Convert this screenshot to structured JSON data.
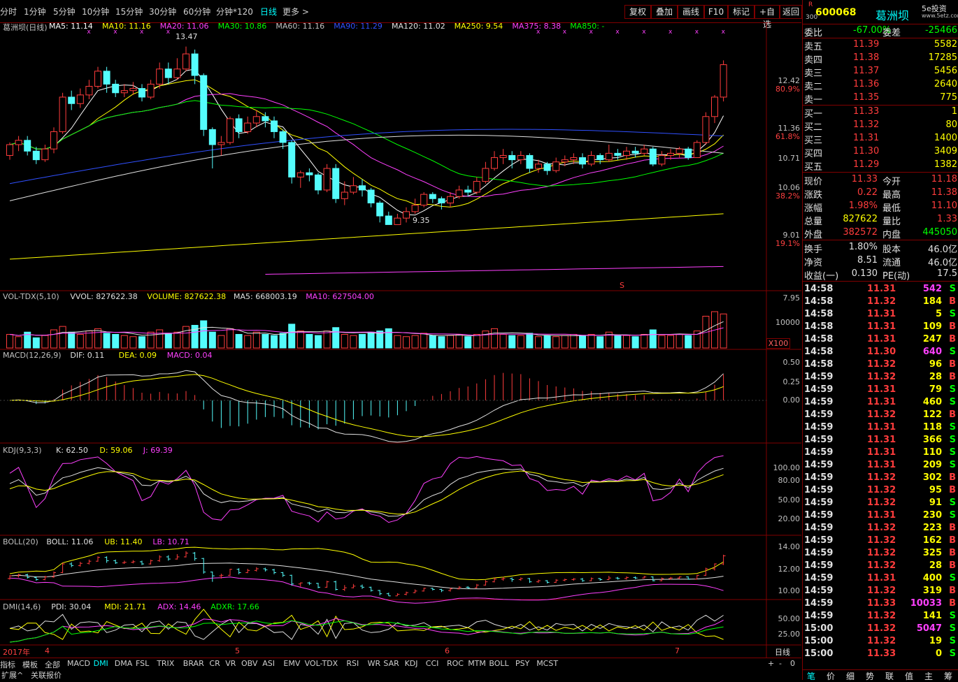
{
  "period_tabs": [
    "分时",
    "1分钟",
    "5分钟",
    "10分钟",
    "15分钟",
    "30分钟",
    "60分钟",
    "分钟*120",
    "日线",
    "更多 >"
  ],
  "active_period": "日线",
  "toolbar_buttons": [
    "复权",
    "叠加",
    "画线",
    "F10",
    "标记",
    "+自选",
    "返回"
  ],
  "main_legend": {
    "stock": "葛洲坝(日线)",
    "items": [
      {
        "label": "MA5: 11.14",
        "color": "#ffffff"
      },
      {
        "label": "MA10: 11.16",
        "color": "#ffff00"
      },
      {
        "label": "MA20: 11.06",
        "color": "#ff40ff"
      },
      {
        "label": "MA30: 10.86",
        "color": "#00ff00"
      },
      {
        "label": "MA60: 11.16",
        "color": "#c0c0c0"
      },
      {
        "label": "MA90: 11.29",
        "color": "#3050ff"
      },
      {
        "label": "MA120: 11.02",
        "color": "#e0e0e0"
      },
      {
        "label": "MA250: 9.54",
        "color": "#ffff00"
      },
      {
        "label": "MA375: 8.38",
        "color": "#ff40ff"
      },
      {
        "label": "MA850: -",
        "color": "#00ff00"
      }
    ]
  },
  "price_axis": [
    {
      "value": "12.42",
      "pct": "80.9%"
    },
    {
      "value": "11.36",
      "pct": "61.8%"
    },
    {
      "value": "10.71",
      "pct": ""
    },
    {
      "value": "10.06",
      "pct": "38.2%"
    },
    {
      "value": "9.01",
      "pct": "19.1%"
    },
    {
      "value": "7.95",
      "pct": ""
    }
  ],
  "annotations": {
    "high": "13.47",
    "low": "9.35"
  },
  "vol_legend": [
    {
      "label": "VOL-TDX(5,10)",
      "color": "#c0c0c0"
    },
    {
      "label": "VVOL: 827622.38",
      "color": "#e0e0e0"
    },
    {
      "label": "VOLUME: 827622.38",
      "color": "#ffff00"
    },
    {
      "label": "MA5: 668003.19",
      "color": "#e0e0e0"
    },
    {
      "label": "MA10: 627504.00",
      "color": "#ff40ff"
    }
  ],
  "vol_axis": {
    "tick": "10000",
    "unit": "X100"
  },
  "macd_legend": [
    {
      "label": "MACD(12,26,9)",
      "color": "#c0c0c0"
    },
    {
      "label": "DIF: 0.11",
      "color": "#e0e0e0"
    },
    {
      "label": "DEA: 0.09",
      "color": "#ffff00"
    },
    {
      "label": "MACD: 0.04",
      "color": "#ff40ff"
    }
  ],
  "macd_axis": [
    "0.50",
    "0.25",
    "0.00"
  ],
  "kdj_legend": [
    {
      "label": "KDJ(9,3,3)",
      "color": "#c0c0c0"
    },
    {
      "label": "K: 62.50",
      "color": "#e0e0e0"
    },
    {
      "label": "D: 59.06",
      "color": "#ffff00"
    },
    {
      "label": "J: 69.39",
      "color": "#ff40ff"
    }
  ],
  "kdj_axis": [
    "100.00",
    "80.00",
    "50.00",
    "20.00"
  ],
  "boll_legend": [
    {
      "label": "BOLL(20)",
      "color": "#c0c0c0"
    },
    {
      "label": "BOLL: 11.06",
      "color": "#e0e0e0"
    },
    {
      "label": "UB: 11.40",
      "color": "#ffff00"
    },
    {
      "label": "LB: 10.71",
      "color": "#ff40ff"
    }
  ],
  "boll_axis": [
    "14.00",
    "12.00",
    "10.00"
  ],
  "dmi_legend": [
    {
      "label": "DMI(14,6)",
      "color": "#c0c0c0"
    },
    {
      "label": "PDI: 30.04",
      "color": "#e0e0e0"
    },
    {
      "label": "MDI: 21.71",
      "color": "#ffff00"
    },
    {
      "label": "ADX: 14.46",
      "color": "#ff40ff"
    },
    {
      "label": "ADXR: 17.66",
      "color": "#00ff00"
    }
  ],
  "dmi_axis": [
    "50.00",
    "25.00"
  ],
  "date_axis": [
    "2017年",
    "4",
    "5",
    "6",
    "7"
  ],
  "date_axis_right": "日线",
  "indicator_tabs": [
    "指标",
    "模板",
    "全部",
    "MACD",
    "DMI",
    "DMA",
    "FSL",
    "TRIX",
    "BRAR",
    "CR",
    "VR",
    "OBV",
    "ASI",
    "EMV",
    "VOL-TDX",
    "RSI",
    "WR",
    "SAR",
    "KDJ",
    "CCI",
    "ROC",
    "MTM",
    "BOLL",
    "PSY",
    "MCST"
  ],
  "active_indicator": "DMI",
  "bottom_tabs": [
    "扩展^",
    "关联报价"
  ],
  "zoom_controls": [
    "+",
    "-",
    "0"
  ],
  "quote": {
    "code": "600068",
    "name": "葛洲坝",
    "market_tag": "R",
    "market_tag2": "300",
    "brand": "5e投资",
    "brand_sub": "www.5etz.com",
    "weibi_label": "委比",
    "weibi": "-67.00%",
    "weicha_label": "委差",
    "weicha": "-25466",
    "asks": [
      {
        "label": "卖五",
        "price": "11.39",
        "vol": "5582"
      },
      {
        "label": "卖四",
        "price": "11.38",
        "vol": "17285"
      },
      {
        "label": "卖三",
        "price": "11.37",
        "vol": "5456"
      },
      {
        "label": "卖二",
        "price": "11.36",
        "vol": "2640"
      },
      {
        "label": "卖一",
        "price": "11.35",
        "vol": "775"
      }
    ],
    "bids": [
      {
        "label": "买一",
        "price": "11.33",
        "vol": "1"
      },
      {
        "label": "买二",
        "price": "11.32",
        "vol": "80"
      },
      {
        "label": "买三",
        "price": "11.31",
        "vol": "1400"
      },
      {
        "label": "买四",
        "price": "11.30",
        "vol": "3409"
      },
      {
        "label": "买五",
        "price": "11.29",
        "vol": "1382"
      }
    ],
    "stats": [
      {
        "l1": "现价",
        "v1": "11.33",
        "c1": "red",
        "l2": "今开",
        "v2": "11.18",
        "c2": "red"
      },
      {
        "l1": "涨跌",
        "v1": "0.22",
        "c1": "red",
        "l2": "最高",
        "v2": "11.38",
        "c2": "red"
      },
      {
        "l1": "涨幅",
        "v1": "1.98%",
        "c1": "red",
        "l2": "最低",
        "v2": "11.10",
        "c2": "red"
      },
      {
        "l1": "总量",
        "v1": "827622",
        "c1": "yel",
        "l2": "量比",
        "v2": "1.33",
        "c2": "red"
      },
      {
        "l1": "外盘",
        "v1": "382572",
        "c1": "red",
        "l2": "内盘",
        "v2": "445050",
        "c2": "grn"
      }
    ],
    "stats2": [
      {
        "l1": "换手",
        "v1": "1.80%",
        "l2": "股本",
        "v2": "46.0亿"
      },
      {
        "l1": "净资",
        "v1": "8.51",
        "l2": "流通",
        "v2": "46.0亿"
      },
      {
        "l1": "收益(一)",
        "v1": "0.130",
        "l2": "PE(动)",
        "v2": "17.5"
      }
    ]
  },
  "ticks": [
    {
      "t": "14:58",
      "p": "11.31",
      "v": "542",
      "s": "S",
      "pc": "red",
      "vc": "mag",
      "sc": "grn"
    },
    {
      "t": "14:58",
      "p": "11.32",
      "v": "184",
      "s": "B",
      "pc": "red",
      "vc": "yel",
      "sc": "red"
    },
    {
      "t": "14:58",
      "p": "11.31",
      "v": "5",
      "s": "S",
      "pc": "red",
      "vc": "yel",
      "sc": "grn"
    },
    {
      "t": "14:58",
      "p": "11.31",
      "v": "109",
      "s": "B",
      "pc": "red",
      "vc": "yel",
      "sc": "red"
    },
    {
      "t": "14:58",
      "p": "11.31",
      "v": "247",
      "s": "B",
      "pc": "red",
      "vc": "yel",
      "sc": "red"
    },
    {
      "t": "14:58",
      "p": "11.30",
      "v": "640",
      "s": "S",
      "pc": "red",
      "vc": "mag",
      "sc": "grn"
    },
    {
      "t": "14:58",
      "p": "11.32",
      "v": "96",
      "s": "B",
      "pc": "red",
      "vc": "yel",
      "sc": "red"
    },
    {
      "t": "14:59",
      "p": "11.32",
      "v": "28",
      "s": "B",
      "pc": "red",
      "vc": "yel",
      "sc": "red"
    },
    {
      "t": "14:59",
      "p": "11.31",
      "v": "79",
      "s": "S",
      "pc": "red",
      "vc": "yel",
      "sc": "grn"
    },
    {
      "t": "14:59",
      "p": "11.31",
      "v": "460",
      "s": "S",
      "pc": "red",
      "vc": "yel",
      "sc": "grn"
    },
    {
      "t": "14:59",
      "p": "11.32",
      "v": "122",
      "s": "B",
      "pc": "red",
      "vc": "yel",
      "sc": "red"
    },
    {
      "t": "14:59",
      "p": "11.31",
      "v": "118",
      "s": "S",
      "pc": "red",
      "vc": "yel",
      "sc": "grn"
    },
    {
      "t": "14:59",
      "p": "11.31",
      "v": "366",
      "s": "S",
      "pc": "red",
      "vc": "yel",
      "sc": "grn"
    },
    {
      "t": "14:59",
      "p": "11.31",
      "v": "110",
      "s": "S",
      "pc": "red",
      "vc": "yel",
      "sc": "grn"
    },
    {
      "t": "14:59",
      "p": "11.31",
      "v": "209",
      "s": "S",
      "pc": "red",
      "vc": "yel",
      "sc": "grn"
    },
    {
      "t": "14:59",
      "p": "11.32",
      "v": "302",
      "s": "B",
      "pc": "red",
      "vc": "yel",
      "sc": "red"
    },
    {
      "t": "14:59",
      "p": "11.32",
      "v": "95",
      "s": "B",
      "pc": "red",
      "vc": "yel",
      "sc": "red"
    },
    {
      "t": "14:59",
      "p": "11.32",
      "v": "91",
      "s": "S",
      "pc": "red",
      "vc": "yel",
      "sc": "grn"
    },
    {
      "t": "14:59",
      "p": "11.31",
      "v": "230",
      "s": "S",
      "pc": "red",
      "vc": "yel",
      "sc": "grn"
    },
    {
      "t": "14:59",
      "p": "11.32",
      "v": "223",
      "s": "B",
      "pc": "red",
      "vc": "yel",
      "sc": "red"
    },
    {
      "t": "14:59",
      "p": "11.32",
      "v": "162",
      "s": "B",
      "pc": "red",
      "vc": "yel",
      "sc": "red"
    },
    {
      "t": "14:59",
      "p": "11.32",
      "v": "325",
      "s": "B",
      "pc": "red",
      "vc": "yel",
      "sc": "red"
    },
    {
      "t": "14:59",
      "p": "11.32",
      "v": "28",
      "s": "B",
      "pc": "red",
      "vc": "yel",
      "sc": "red"
    },
    {
      "t": "14:59",
      "p": "11.31",
      "v": "400",
      "s": "S",
      "pc": "red",
      "vc": "yel",
      "sc": "grn"
    },
    {
      "t": "14:59",
      "p": "11.32",
      "v": "319",
      "s": "B",
      "pc": "red",
      "vc": "yel",
      "sc": "red"
    },
    {
      "t": "14:59",
      "p": "11.33",
      "v": "10033",
      "s": "B",
      "pc": "red",
      "vc": "mag",
      "sc": "red"
    },
    {
      "t": "14:59",
      "p": "11.32",
      "v": "141",
      "s": "S",
      "pc": "red",
      "vc": "yel",
      "sc": "grn"
    },
    {
      "t": "15:00",
      "p": "11.32",
      "v": "5047",
      "s": "S",
      "pc": "red",
      "vc": "mag",
      "sc": "grn"
    },
    {
      "t": "15:00",
      "p": "11.32",
      "v": "19",
      "s": "S",
      "pc": "red",
      "vc": "yel",
      "sc": "grn"
    },
    {
      "t": "15:00",
      "p": "11.33",
      "v": "0",
      "s": "S",
      "pc": "red",
      "vc": "yel",
      "sc": "grn"
    }
  ],
  "right_tabs": [
    "笔",
    "价",
    "细",
    "势",
    "联",
    "值",
    "主",
    "筹"
  ],
  "chart_data": {
    "type": "candlestick",
    "candles": [
      [
        10.95,
        11.2,
        10.85,
        11.25
      ],
      [
        11.2,
        11.3,
        11.05,
        11.4
      ],
      [
        11.3,
        11.05,
        10.95,
        11.4
      ],
      [
        11.05,
        10.85,
        10.75,
        11.15
      ],
      [
        10.85,
        11.1,
        10.8,
        11.2
      ],
      [
        11.1,
        11.5,
        11.0,
        11.6
      ],
      [
        11.5,
        12.3,
        11.45,
        12.4
      ],
      [
        12.3,
        12.15,
        12.0,
        12.45
      ],
      [
        12.15,
        12.35,
        12.05,
        12.5
      ],
      [
        12.35,
        12.55,
        12.25,
        12.7
      ],
      [
        12.55,
        12.9,
        12.5,
        13.0
      ],
      [
        12.9,
        12.6,
        12.4,
        13.0
      ],
      [
        12.6,
        12.4,
        12.3,
        12.7
      ],
      [
        12.4,
        12.45,
        12.3,
        12.6
      ],
      [
        12.45,
        12.5,
        12.35,
        12.65
      ],
      [
        12.5,
        12.3,
        12.2,
        12.6
      ],
      [
        12.3,
        12.6,
        12.25,
        12.7
      ],
      [
        12.6,
        12.95,
        12.5,
        13.1
      ],
      [
        12.95,
        12.75,
        12.6,
        13.1
      ],
      [
        12.75,
        12.95,
        12.7,
        13.2
      ],
      [
        12.95,
        13.3,
        12.9,
        13.47
      ],
      [
        13.3,
        12.8,
        12.6,
        13.4
      ],
      [
        12.8,
        11.55,
        11.4,
        12.85
      ],
      [
        11.55,
        11.2,
        10.65,
        11.6
      ],
      [
        11.2,
        11.25,
        10.95,
        11.4
      ],
      [
        11.25,
        11.8,
        11.2,
        11.85
      ],
      [
        11.8,
        11.5,
        11.35,
        11.9
      ],
      [
        11.5,
        11.7,
        11.45,
        11.85
      ],
      [
        11.7,
        11.85,
        11.6,
        12.0
      ],
      [
        11.85,
        11.75,
        11.6,
        11.95
      ],
      [
        11.75,
        11.5,
        11.35,
        11.85
      ],
      [
        11.5,
        11.25,
        11.1,
        11.55
      ],
      [
        11.25,
        10.45,
        10.3,
        11.3
      ],
      [
        10.45,
        10.55,
        10.2,
        10.6
      ],
      [
        10.55,
        10.5,
        10.35,
        10.65
      ],
      [
        10.5,
        10.15,
        10.05,
        10.55
      ],
      [
        10.15,
        10.65,
        10.1,
        10.75
      ],
      [
        10.65,
        9.95,
        9.85,
        10.75
      ],
      [
        9.95,
        10.1,
        9.8,
        10.35
      ],
      [
        10.1,
        10.25,
        10.05,
        10.45
      ],
      [
        10.25,
        10.15,
        10.0,
        10.4
      ],
      [
        10.15,
        9.85,
        9.75,
        10.2
      ],
      [
        9.85,
        9.55,
        9.4,
        9.9
      ],
      [
        9.55,
        9.35,
        9.35,
        9.65
      ],
      [
        9.35,
        9.5,
        9.35,
        9.6
      ],
      [
        9.5,
        9.65,
        9.4,
        9.75
      ],
      [
        9.65,
        9.8,
        9.6,
        9.95
      ],
      [
        9.8,
        10.05,
        9.75,
        10.1
      ],
      [
        10.05,
        9.95,
        9.85,
        10.1
      ],
      [
        9.95,
        9.85,
        9.7,
        10.0
      ],
      [
        9.85,
        10.0,
        9.75,
        10.1
      ],
      [
        10.0,
        10.15,
        9.95,
        10.25
      ],
      [
        10.15,
        10.1,
        10.0,
        10.25
      ],
      [
        10.1,
        10.35,
        10.05,
        10.45
      ],
      [
        10.35,
        10.65,
        10.3,
        10.8
      ],
      [
        10.65,
        10.9,
        10.6,
        11.05
      ],
      [
        10.9,
        10.95,
        10.75,
        11.1
      ],
      [
        10.95,
        10.85,
        10.65,
        11.05
      ],
      [
        10.85,
        10.95,
        10.75,
        11.05
      ],
      [
        10.95,
        10.65,
        10.55,
        11.0
      ],
      [
        10.65,
        10.75,
        10.55,
        10.85
      ],
      [
        10.75,
        10.6,
        10.5,
        10.8
      ],
      [
        10.6,
        10.8,
        10.55,
        10.9
      ],
      [
        10.8,
        10.85,
        10.7,
        10.95
      ],
      [
        10.85,
        10.9,
        10.75,
        11.0
      ],
      [
        10.9,
        10.75,
        10.65,
        11.0
      ],
      [
        10.75,
        10.95,
        10.7,
        11.05
      ],
      [
        10.95,
        10.85,
        10.75,
        11.0
      ],
      [
        10.85,
        11.0,
        10.8,
        11.2
      ],
      [
        11.0,
        10.95,
        10.85,
        11.1
      ],
      [
        10.95,
        11.05,
        10.85,
        11.15
      ],
      [
        11.05,
        11.0,
        10.9,
        11.15
      ],
      [
        11.0,
        11.1,
        10.95,
        11.2
      ],
      [
        11.1,
        10.75,
        10.7,
        11.15
      ],
      [
        10.75,
        10.95,
        10.7,
        11.05
      ],
      [
        10.95,
        11.0,
        10.85,
        11.1
      ],
      [
        11.0,
        11.1,
        10.9,
        11.15
      ],
      [
        11.1,
        10.9,
        10.85,
        11.15
      ],
      [
        10.9,
        11.25,
        10.9,
        11.3
      ],
      [
        11.25,
        11.85,
        11.2,
        11.95
      ],
      [
        11.85,
        12.3,
        11.7,
        12.35
      ],
      [
        12.3,
        13.05,
        12.2,
        13.15
      ]
    ],
    "volumes": [
      0.6,
      0.5,
      0.7,
      0.45,
      0.55,
      0.8,
      0.95,
      0.7,
      0.6,
      0.75,
      0.85,
      0.65,
      0.6,
      0.55,
      0.5,
      0.5,
      0.7,
      0.8,
      0.65,
      0.7,
      0.95,
      1.0,
      1.2,
      0.7,
      0.55,
      0.85,
      0.6,
      0.55,
      0.7,
      0.6,
      0.55,
      0.65,
      1.05,
      0.75,
      0.6,
      0.55,
      0.75,
      0.9,
      0.6,
      0.55,
      0.6,
      0.7,
      0.75,
      0.85,
      0.55,
      0.5,
      0.55,
      0.65,
      0.55,
      0.5,
      0.55,
      0.6,
      0.5,
      0.6,
      0.75,
      0.85,
      0.6,
      0.55,
      0.55,
      0.65,
      0.5,
      0.55,
      0.5,
      0.55,
      0.6,
      0.55,
      0.6,
      0.5,
      0.7,
      0.55,
      0.55,
      0.5,
      0.6,
      0.8,
      0.55,
      0.55,
      0.6,
      0.55,
      0.75,
      1.4,
      1.6,
      1.5
    ],
    "ma_lines": [
      {
        "name": "MA5",
        "color": "#ffffff"
      },
      {
        "name": "MA10",
        "color": "#ffff00"
      },
      {
        "name": "MA20",
        "color": "#ff40ff"
      },
      {
        "name": "MA30",
        "color": "#00ff00"
      },
      {
        "name": "MA90",
        "color": "#3050ff"
      },
      {
        "name": "MA120",
        "color": "#e0e0e0"
      },
      {
        "name": "MA250",
        "color": "#ffff00"
      },
      {
        "name": "MA375",
        "color": "#ff40ff"
      }
    ],
    "ylim": [
      7.95,
      13.9
    ],
    "xlabel": "",
    "ylabel": ""
  }
}
